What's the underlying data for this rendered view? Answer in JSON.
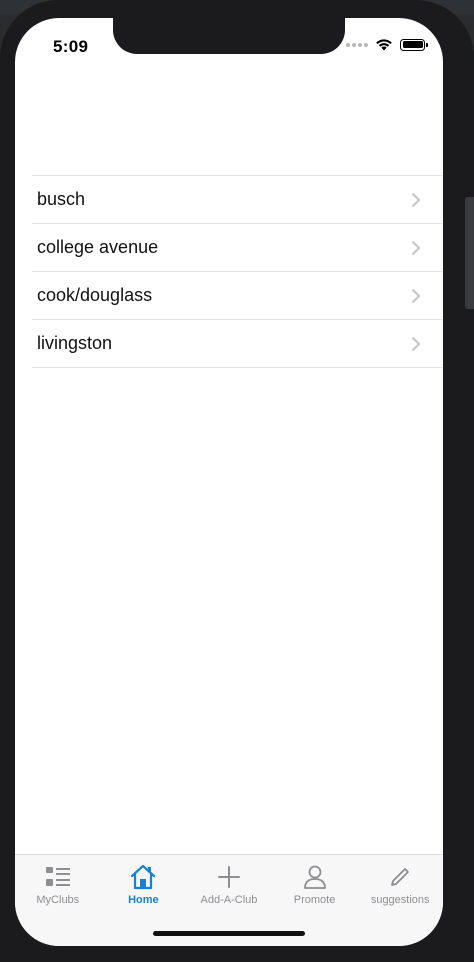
{
  "status_bar": {
    "time": "5:09"
  },
  "campus_list": {
    "items": [
      {
        "label": "busch"
      },
      {
        "label": "college avenue"
      },
      {
        "label": "cook/douglass"
      },
      {
        "label": "livingston"
      }
    ]
  },
  "tab_bar": {
    "tabs": [
      {
        "label": "MyClubs",
        "icon": "list-icon"
      },
      {
        "label": "Home",
        "icon": "home-icon",
        "active": true
      },
      {
        "label": "Add-A-Club",
        "icon": "plus-icon"
      },
      {
        "label": "Promote",
        "icon": "person-icon"
      },
      {
        "label": "suggestions",
        "icon": "pencil-icon"
      }
    ]
  },
  "colors": {
    "accent": "#1b7fd6",
    "inactive_tab": "#8e8e93",
    "chevron": "#c4c4c7"
  }
}
